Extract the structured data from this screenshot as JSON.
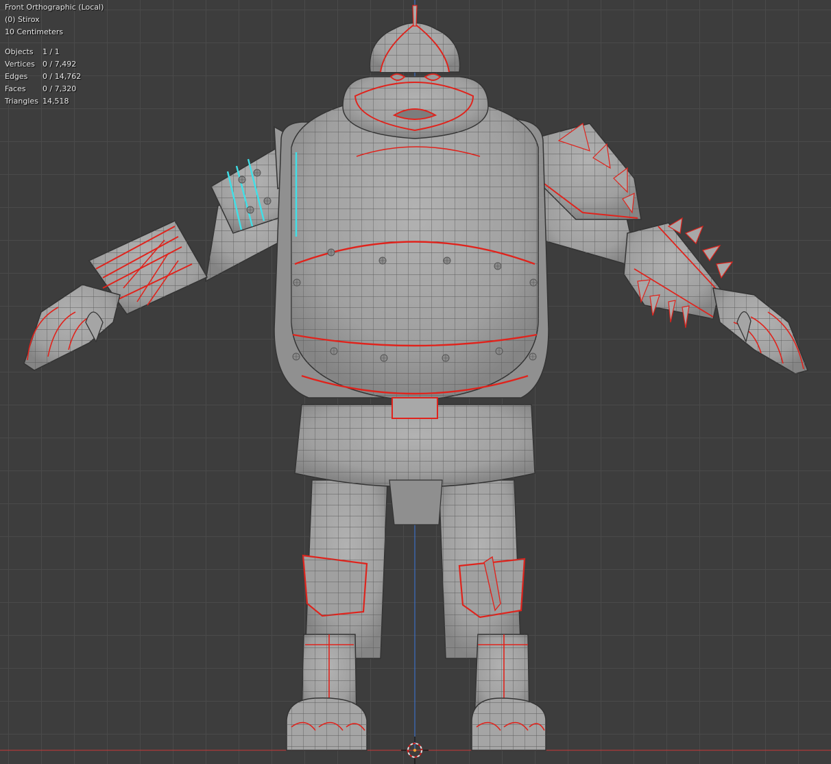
{
  "viewport": {
    "view_name": "Front Orthographic (Local)",
    "object_name": "(0) Stirox",
    "grid_scale": "10 Centimeters"
  },
  "stats": [
    {
      "label": "Objects",
      "value": "1 / 1"
    },
    {
      "label": "Vertices",
      "value": "0 / 7,492"
    },
    {
      "label": "Edges",
      "value": "0 / 14,762"
    },
    {
      "label": "Faces",
      "value": "0 / 7,320"
    },
    {
      "label": "Triangles",
      "value": "14,518"
    }
  ],
  "colors": {
    "background": "#3d3d3d",
    "grid_line": "#4a4a4a",
    "mesh_fill": "#a3a3a3",
    "wire": "#5c5c5c",
    "seam": "#e0231c",
    "sharp": "#3fe0e8",
    "x_axis": "#b03a3a",
    "z_axis": "#3d6fc4",
    "cursor_outer": "#e0e0e0",
    "cursor_inner": "#d02020"
  },
  "icons": {
    "origin": "3d-cursor-icon"
  }
}
